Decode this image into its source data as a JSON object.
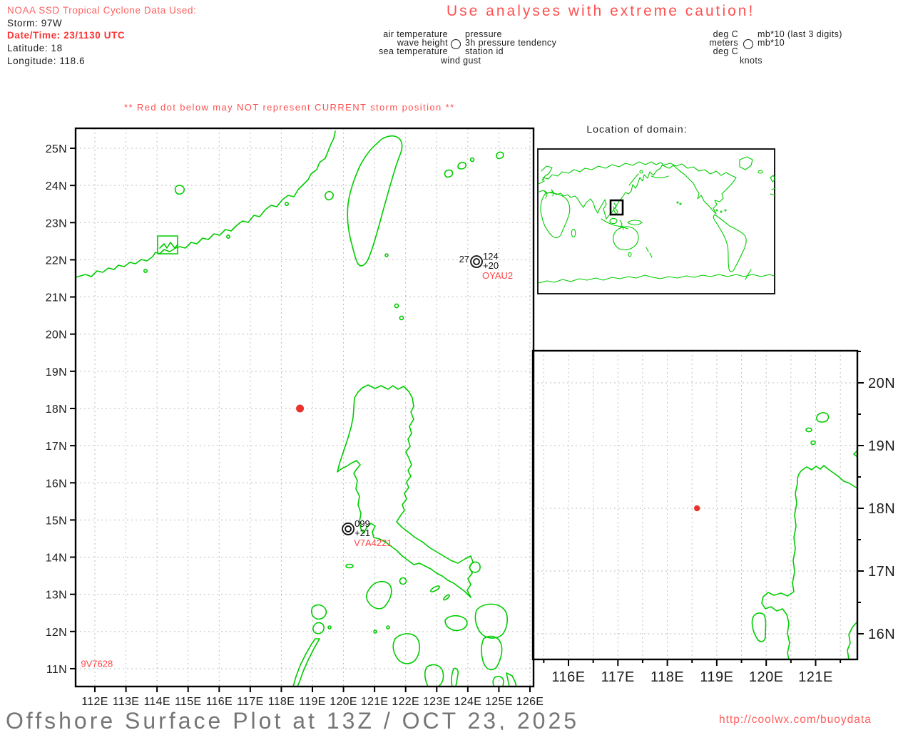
{
  "colors": {
    "land_green": "#00cc00",
    "alert_red": "#ff5050",
    "alert_red_strong": "#ff3434",
    "alert_red_light": "#ff6262",
    "station_id_red": "#ff4444",
    "storm_dot_red": "#e8342c",
    "grid_gray": "#b5b5b5",
    "ink": "#1c1c1c",
    "footer_gray": "#767676"
  },
  "header": {
    "source_label": "NOAA SSD Tropical Cyclone Data Used:",
    "storm": "Storm: 97W",
    "datetime": "Date/Time: 23/1130 UTC",
    "latitude": "Latitude: 18",
    "longitude": "Longitude: 118.6",
    "caution": "Use analyses with extreme caution!"
  },
  "legend": {
    "variables": {
      "air": "air temperature",
      "wave": "wave height",
      "sea": "sea temperature",
      "gust": "wind gust",
      "pressure": "pressure",
      "tendency": "3h pressure tendency",
      "station": "station id"
    },
    "units": {
      "air": "deg C",
      "wave": "meters",
      "sea": "deg C",
      "gust": "knots",
      "pressure": "mb*10 (last 3 digits)",
      "tendency": "mb*10"
    }
  },
  "warning": "** Red dot below may NOT represent CURRENT storm position **",
  "domain_map": {
    "title": "Location of domain:"
  },
  "main_map": {
    "lat_ticks": [
      "25N",
      "24N",
      "23N",
      "22N",
      "21N",
      "20N",
      "19N",
      "18N",
      "17N",
      "16N",
      "15N",
      "14N",
      "13N",
      "12N",
      "11N"
    ],
    "lon_ticks": [
      "112E",
      "113E",
      "114E",
      "115E",
      "116E",
      "117E",
      "118E",
      "119E",
      "120E",
      "121E",
      "122E",
      "123E",
      "124E",
      "125E",
      "126E"
    ],
    "storm_dot": {
      "lat": 18,
      "lon": 118.6
    },
    "stations": [
      {
        "id": "OYAU2",
        "lat": 21.95,
        "lon": 124.28,
        "air_temp": "27",
        "pressure": "124",
        "tendency": "+20",
        "symbol": "double-circle"
      },
      {
        "id": "V7A4221",
        "lat": 14.76,
        "lon": 120.15,
        "air_temp": "",
        "pressure": "099",
        "tendency": "+21",
        "symbol": "double-circle"
      },
      {
        "id": "9V7628",
        "lat": 11.12,
        "lon": 111.55,
        "air_temp": "",
        "pressure": "",
        "tendency": "",
        "symbol": "none"
      }
    ]
  },
  "inset_map": {
    "lat_ticks": [
      "20N",
      "19N",
      "18N",
      "17N",
      "16N"
    ],
    "lon_ticks": [
      "116E",
      "117E",
      "118E",
      "119E",
      "120E",
      "121E"
    ],
    "storm_dot": {
      "lat": 18,
      "lon": 118.6
    }
  },
  "footer": {
    "title": "Offshore Surface Plot at 13Z / OCT 23, 2025",
    "url": "http://coolwx.com/buoydata"
  }
}
